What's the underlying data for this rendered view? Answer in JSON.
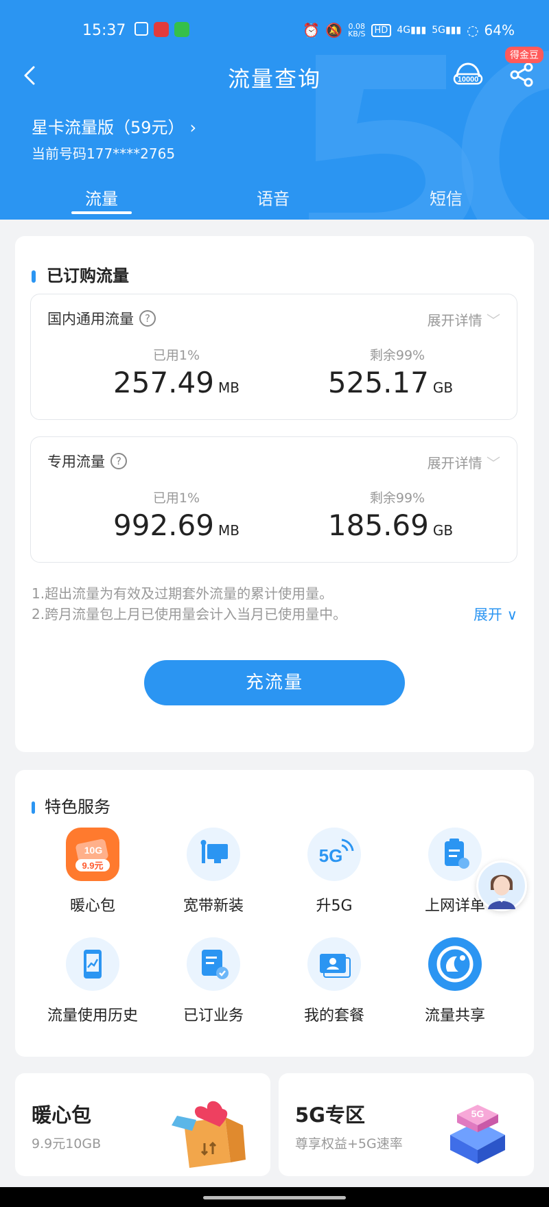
{
  "status_bar": {
    "time": "15:37",
    "net_speed": "0.08",
    "net_unit": "KB/S",
    "hd": "HD",
    "sig1": "4G",
    "sig2": "5G",
    "battery": "64%"
  },
  "nav": {
    "title": "流量查询",
    "service_label": "10000",
    "bean_badge": "得金豆"
  },
  "plan": {
    "name": "星卡流量版（59元）",
    "phone": "当前号码177****2765"
  },
  "tabs": [
    "流量",
    "语音",
    "短信"
  ],
  "purchased": {
    "title": "已订购流量",
    "domestic": {
      "label": "国内通用流量",
      "expand": "展开详情",
      "used_label": "已用1%",
      "used_value": "257.49",
      "used_unit": "MB",
      "remain_label": "剩余99%",
      "remain_value": "525.17",
      "remain_unit": "GB"
    },
    "dedicated": {
      "label": "专用流量",
      "expand": "展开详情",
      "used_label": "已用1%",
      "used_value": "992.69",
      "used_unit": "MB",
      "remain_label": "剩余99%",
      "remain_value": "185.69",
      "remain_unit": "GB"
    },
    "note1": "1.超出流量为有效及过期套外流量的累计使用量。",
    "note2": "2.跨月流量包上月已使用量会计入当月已使用量中。",
    "notes_expand": "展开",
    "recharge": "充流量"
  },
  "services": {
    "title": "特色服务",
    "items": [
      {
        "label": "暖心包",
        "badge_top": "10G",
        "badge_price": "9.9元"
      },
      {
        "label": "宽带新装"
      },
      {
        "label": "升5G",
        "icon_text": "5G"
      },
      {
        "label": "上网详单"
      },
      {
        "label": "流量使用历史"
      },
      {
        "label": "已订业务"
      },
      {
        "label": "我的套餐"
      },
      {
        "label": "流量共享"
      }
    ]
  },
  "promos": [
    {
      "title": "暖心包",
      "subtitle": "9.9元10GB"
    },
    {
      "title": "5G专区",
      "subtitle": "尊享权益+5G速率",
      "badge": "5G"
    }
  ],
  "colors": {
    "accent": "#2b95f2",
    "badge": "#ff5a5a",
    "orange": "#ff7a2e"
  }
}
